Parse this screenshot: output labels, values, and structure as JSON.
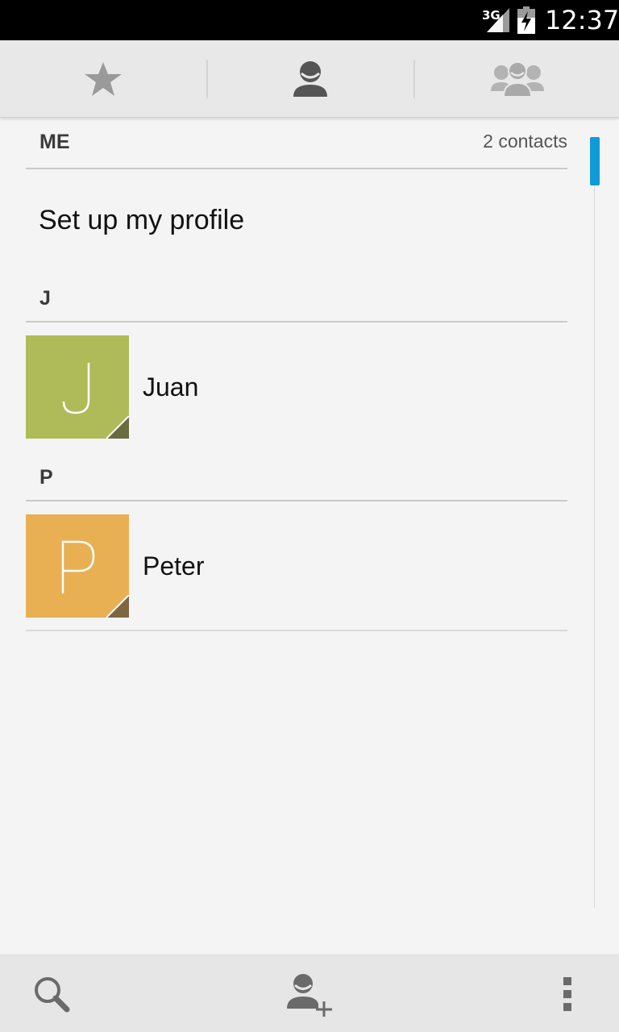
{
  "status_bar": {
    "network": "3G",
    "time": "12:37"
  },
  "tabs": [
    {
      "name": "favorites",
      "icon": "star-icon",
      "selected": false
    },
    {
      "name": "contacts",
      "icon": "person-icon",
      "selected": true
    },
    {
      "name": "groups",
      "icon": "group-icon",
      "selected": false
    }
  ],
  "me_section": {
    "header": "ME",
    "count": "2 contacts",
    "setup_profile_label": "Set up my profile"
  },
  "sections": [
    {
      "letter": "J",
      "contacts": [
        {
          "name": "Juan",
          "initial": "J",
          "color": "#aebb58",
          "corner_color": "#6b6b40"
        }
      ]
    },
    {
      "letter": "P",
      "contacts": [
        {
          "name": "Peter",
          "initial": "P",
          "color": "#e8b052",
          "corner_color": "#7d6640"
        }
      ]
    }
  ],
  "bottom_bar": {
    "actions": [
      {
        "name": "search",
        "icon": "search-icon"
      },
      {
        "name": "add-contact",
        "icon": "add-contact-icon"
      },
      {
        "name": "overflow-menu",
        "icon": "more-vert-icon"
      }
    ]
  },
  "colors": {
    "accent": "#0f9bd7",
    "background": "#f4f4f4",
    "tab_bar": "#e8e8e8"
  }
}
